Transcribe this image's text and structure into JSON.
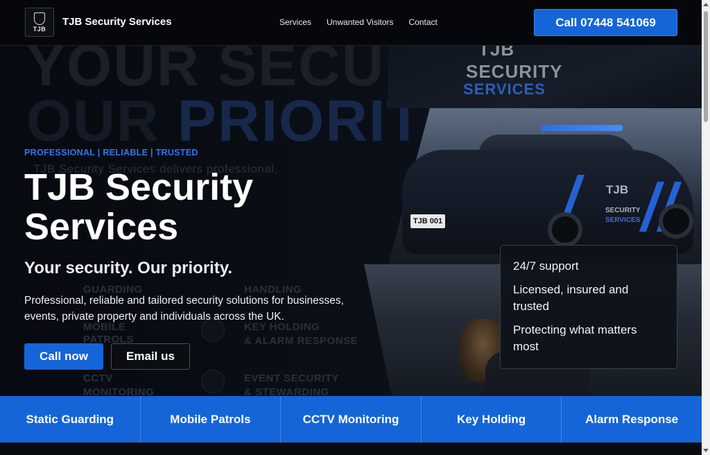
{
  "header": {
    "logo_text": "TJB",
    "brand": "TJB Security Services",
    "nav": [
      "Services",
      "Unwanted Visitors",
      "Contact"
    ],
    "call_label": "Call 07448 541069"
  },
  "hero": {
    "bg_line1": "YOUR SECURITY.",
    "bg_line2_a": "OUR ",
    "bg_line2_b": "PRIORITY.",
    "ghost_intro": "TJB Security Services delivers professional,",
    "ghost_items": [
      "GUARDING",
      "MOBILE",
      "PATROLS",
      "KEY HOLDING",
      "& ALARM RESPONSE",
      "CCTV",
      "MONITORING",
      "EVENT SECURITY",
      "& STEWARDING",
      "HANDLING"
    ],
    "vest_title": "TJB",
    "vest_line1": "SECURITY",
    "vest_line2": "SERVICES",
    "car_plate": "TJB 001",
    "car_text": [
      "TJB",
      "SECURITY",
      "SERVICES"
    ],
    "tagline": "PROFESSIONAL | RELIABLE | TRUSTED",
    "title_line1": "TJB Security",
    "title_line2": "Services",
    "subtitle": "Your security. Our priority.",
    "description": "Professional, reliable and tailored security solutions for businesses, events, private property and individuals across the UK.",
    "btn_call": "Call now",
    "btn_email": "Email us"
  },
  "card": {
    "items": [
      "24/7 support",
      "Licensed, insured and trusted",
      "Protecting what matters most"
    ]
  },
  "services": [
    "Static Guarding",
    "Mobile Patrols",
    "CCTV Monitoring",
    "Key Holding",
    "Alarm Response"
  ],
  "colors": {
    "accent": "#1565d8",
    "tagline": "#2e78ee",
    "background": "#06080d"
  }
}
